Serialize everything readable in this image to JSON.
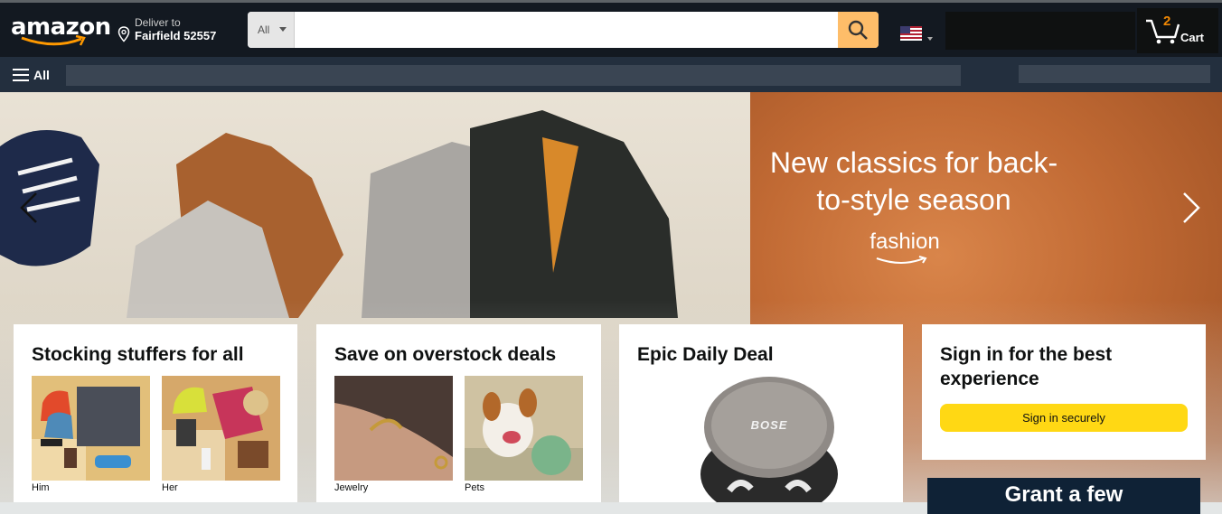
{
  "header": {
    "logo_text": "amazon",
    "deliver_to_label": "Deliver to",
    "deliver_to_location": "Fairfield 52557",
    "search": {
      "category": "All",
      "placeholder": ""
    },
    "cart": {
      "count": "2",
      "label": "Cart"
    }
  },
  "subnav": {
    "all_label": "All"
  },
  "hero": {
    "title": "New classics for back-to-style season",
    "brand": "fashion"
  },
  "cards": {
    "stocking": {
      "title": "Stocking stuffers for all",
      "items": [
        {
          "label": "Him"
        },
        {
          "label": "Her"
        }
      ]
    },
    "overstock": {
      "title": "Save on overstock deals",
      "items": [
        {
          "label": "Jewelry"
        },
        {
          "label": "Pets"
        }
      ]
    },
    "deal": {
      "title": "Epic Daily Deal",
      "product_brand": "BOSE"
    },
    "signin": {
      "title": "Sign in for the best experience",
      "button": "Sign in securely"
    }
  },
  "promo": {
    "text": "Grant a few"
  },
  "colors": {
    "navbar": "#131921",
    "subnav": "#232f3e",
    "search_button": "#febd69",
    "signin_button": "#ffd814",
    "cart_count": "#f08804"
  }
}
